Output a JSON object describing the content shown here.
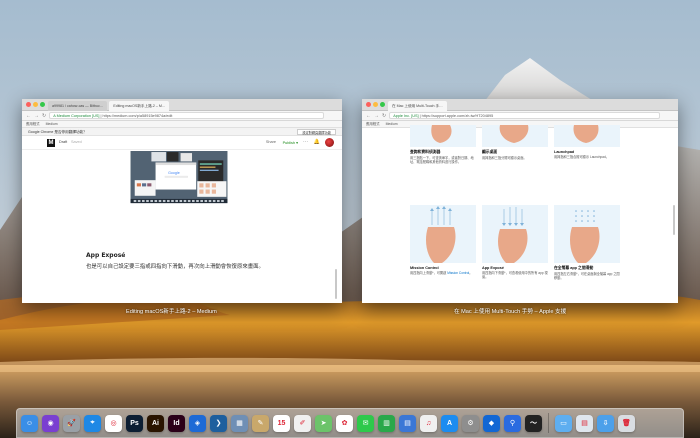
{
  "left_window": {
    "tabs": [
      "a99981 / cahow-cas — Bitbuc…",
      "Editing macOS新手上路-2 – M…"
    ],
    "url_secure": "A Medium Corporation [US]",
    "url": "https://medium.com/p/a58915e9874a/edit",
    "bookmarks": [
      "應用程式",
      "Medium"
    ],
    "translate_prompt": "Google Chrome 是否停用翻譯功能？",
    "translate_button": "設定對網頁翻譯功能",
    "medium": {
      "draft": "Draft",
      "saved": "Saved",
      "share": "Share",
      "publish": "Publish ▾",
      "more": "···",
      "bell": "🔔"
    },
    "article_title": "App Exposé",
    "article_body": "也是可以自己設定要三指或四指向下滑動，再次向上滑動會恢復原來畫面。",
    "caption": "Editing macOS新手上路-2 – Medium"
  },
  "right_window": {
    "tabs": [
      "在 Mac 上使用 Multi-Touch 手…"
    ],
    "url_secure": "Apple Inc. [US]",
    "url": "https://support.apple.com/zh-tw/HT204895",
    "bookmarks": [
      "應用程式",
      "Medium"
    ],
    "cards_top": [
      {
        "title": "查詢和資料偵測器",
        "desc": "用三指點一下，可查詢單字，或者對日期、地址、電話號碼和其他資料進行操作。"
      },
      {
        "title": "顯示桌面",
        "desc": "用拇指和三指分開可顯示桌面。"
      },
      {
        "title": "Launchpad",
        "desc": "用拇指和三指合攏可顯示 Launchpad。"
      }
    ],
    "cards_bottom": [
      {
        "title": "Mission Control",
        "desc": "用四指向上滑動*，可開啟",
        "link": "Mission Control",
        "tail": "。"
      },
      {
        "title": "App Exposé",
        "desc": "用四指向下滑動*，可查看使用中的所有 app 視窗。",
        "link": "",
        "tail": ""
      },
      {
        "title": "在全螢幕 app 之間滑動",
        "desc": "用四指左右滑動*，可在桌面與全螢幕 app 之間移動。",
        "link": "",
        "tail": ""
      }
    ],
    "caption": "在 Mac 上使用 Multi-Touch 手勢 – Apple 支援"
  },
  "dock": {
    "apps": [
      {
        "icon": "finder-icon",
        "color": "#3a8ee6",
        "glyph": "☺"
      },
      {
        "icon": "siri-icon",
        "color": "#7a3fd1",
        "glyph": "◉"
      },
      {
        "icon": "launchpad-icon",
        "color": "#9aa0a6",
        "glyph": "🚀"
      },
      {
        "icon": "safari-icon",
        "color": "#1e88e5",
        "glyph": "⌖"
      },
      {
        "icon": "chrome-icon",
        "color": "#ffffff",
        "glyph": "◎"
      },
      {
        "icon": "photoshop-icon",
        "color": "#0c1e33",
        "glyph": "Ps"
      },
      {
        "icon": "illustrator-icon",
        "color": "#2a1400",
        "glyph": "Ai"
      },
      {
        "icon": "indesign-icon",
        "color": "#2b0018",
        "glyph": "Id"
      },
      {
        "icon": "sourcetree-icon",
        "color": "#1d6ad6",
        "glyph": "◈"
      },
      {
        "icon": "vscode-icon",
        "color": "#1e5f9e",
        "glyph": "❯"
      },
      {
        "icon": "preview-icon",
        "color": "#6f8fb5",
        "glyph": "▦"
      },
      {
        "icon": "notes-icon",
        "color": "#c9a86b",
        "glyph": "✎"
      },
      {
        "icon": "calendar-icon",
        "color": "#ffffff",
        "glyph": "15"
      },
      {
        "icon": "textedit-icon",
        "color": "#f0f0f0",
        "glyph": "✐"
      },
      {
        "icon": "maps-icon",
        "color": "#6cc36a",
        "glyph": "➤"
      },
      {
        "icon": "photos-icon",
        "color": "#ffffff",
        "glyph": "✿"
      },
      {
        "icon": "messages-icon",
        "color": "#2ec94b",
        "glyph": "✉"
      },
      {
        "icon": "numbers-icon",
        "color": "#2aa84a",
        "glyph": "▥"
      },
      {
        "icon": "keynote-icon",
        "color": "#3b77d6",
        "glyph": "▤"
      },
      {
        "icon": "itunes-icon",
        "color": "#f0f0f0",
        "glyph": "♫"
      },
      {
        "icon": "appstore-icon",
        "color": "#1c8cf0",
        "glyph": "A"
      },
      {
        "icon": "system-preferences-icon",
        "color": "#8e8e8e",
        "glyph": "⚙"
      },
      {
        "icon": "sketch-icon",
        "color": "#1267d4",
        "glyph": "◆"
      },
      {
        "icon": "google-maps-icon",
        "color": "#2a6be0",
        "glyph": "⚲"
      },
      {
        "icon": "activity-monitor-icon",
        "color": "#222222",
        "glyph": "〜"
      }
    ],
    "stacks": [
      {
        "icon": "folder-icon",
        "color": "#5eaef0",
        "glyph": "▭"
      },
      {
        "icon": "documents-icon",
        "color": "#dfe6ee",
        "glyph": "▤"
      },
      {
        "icon": "downloads-icon",
        "color": "#4ca0ea",
        "glyph": "⇩"
      },
      {
        "icon": "trash-icon",
        "color": "#d9dde2",
        "glyph": "🗑"
      }
    ]
  }
}
